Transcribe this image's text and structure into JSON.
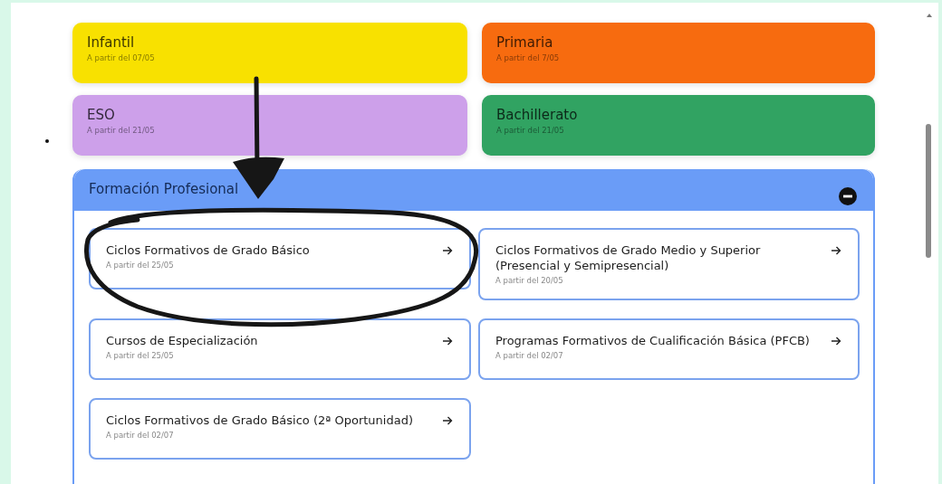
{
  "levels": [
    {
      "title": "Infantil",
      "subtitle": "A partir del 07/05",
      "color": "#f8e100"
    },
    {
      "title": "Primaria",
      "subtitle": "A partir del 7/05",
      "color": "#f76b0f"
    },
    {
      "title": "ESO",
      "subtitle": "A partir del 21/05",
      "color": "#cda0ea"
    },
    {
      "title": "Bachillerato",
      "subtitle": "A partir del 21/05",
      "color": "#31a362"
    }
  ],
  "formacion_profesional": {
    "title": "Formación Profesional",
    "expanded": true,
    "items": [
      {
        "title": "Ciclos Formativos de Grado Básico",
        "subtitle": "A partir del 25/05"
      },
      {
        "title": "Ciclos Formativos de Grado Medio y Superior (Presencial y Semipresencial)",
        "subtitle": "A partir del 20/05"
      },
      {
        "title": "Cursos de Especialización",
        "subtitle": "A partir del 25/05"
      },
      {
        "title": "Programas Formativos de Cualificación Básica (PFCB)",
        "subtitle": "A partir del 02/07"
      },
      {
        "title": "Ciclos Formativos de Grado Básico (2ª Oportunidad)",
        "subtitle": "A partir del 02/07"
      }
    ]
  }
}
